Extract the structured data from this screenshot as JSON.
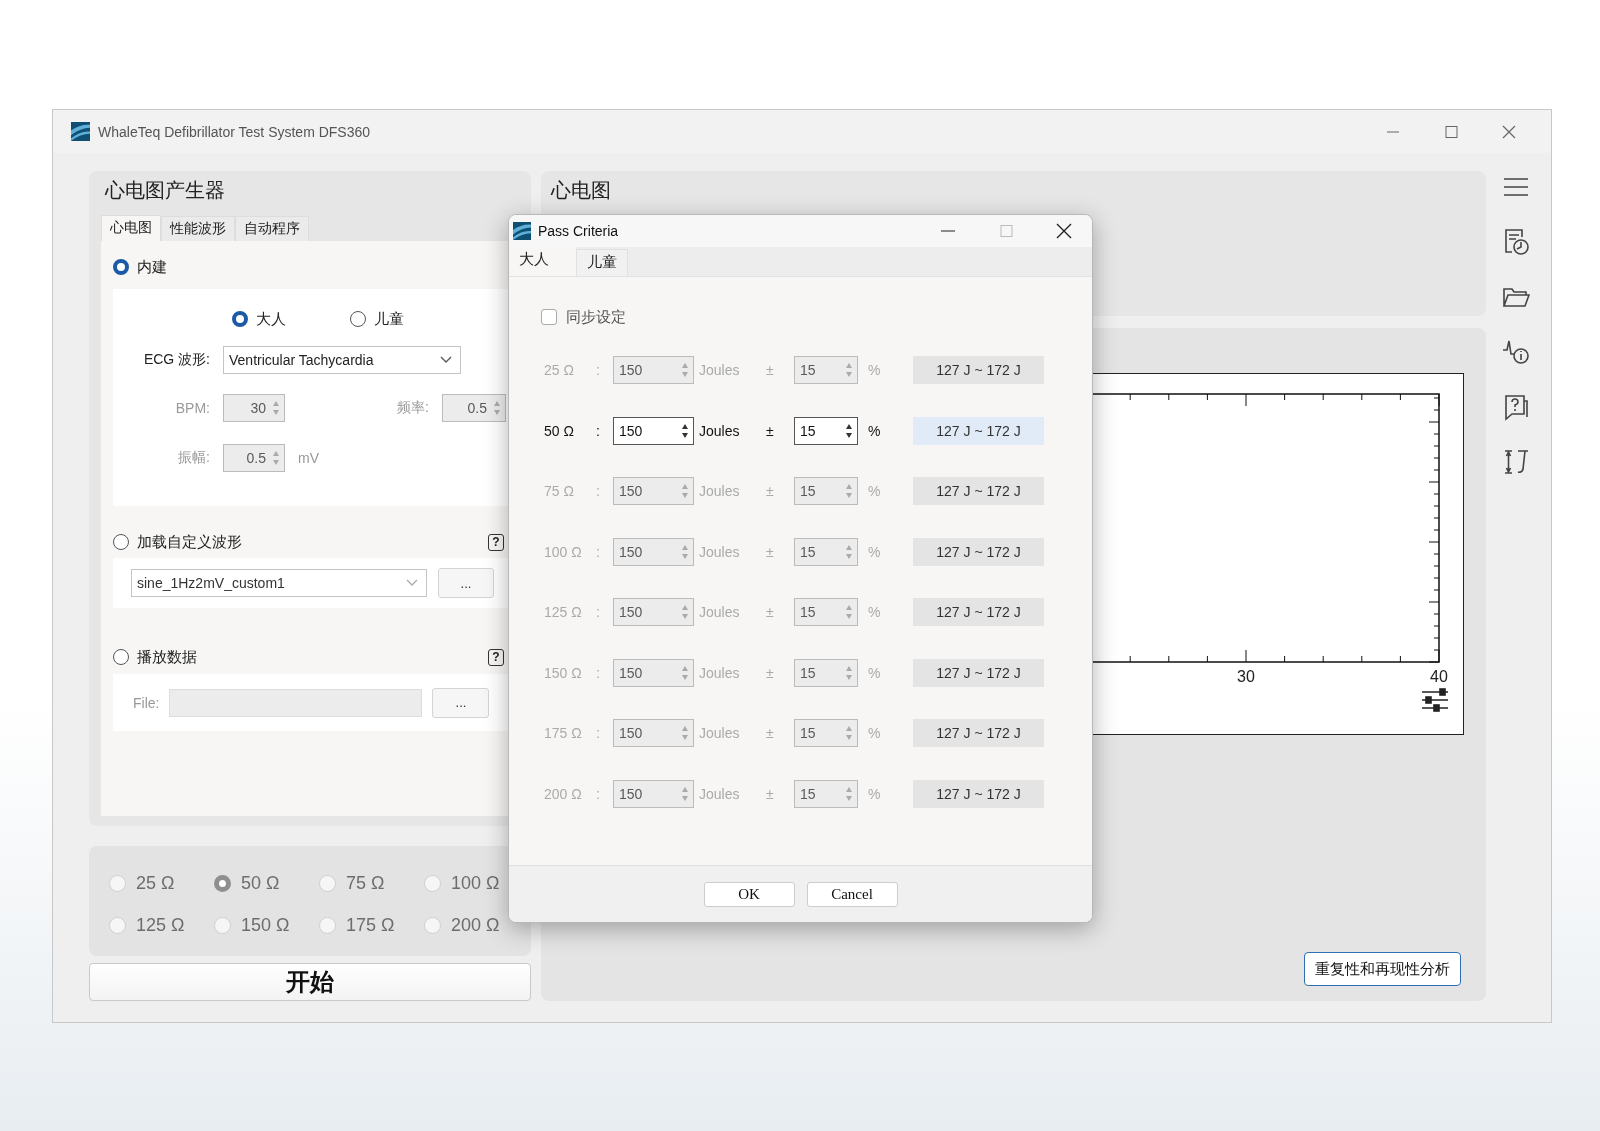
{
  "window": {
    "title": "WhaleTeq Defibrillator Test System DFS360"
  },
  "generator": {
    "title": "心电图产生器",
    "tabs": [
      {
        "label": "心电图",
        "selected": true
      },
      {
        "label": "性能波形",
        "selected": false
      },
      {
        "label": "自动程序",
        "selected": false
      }
    ],
    "builtin": {
      "label": "内建",
      "selected": true,
      "patient": [
        {
          "label": "大人",
          "selected": true
        },
        {
          "label": "儿童",
          "selected": false
        }
      ],
      "waveform": {
        "label": "ECG 波形:",
        "value": "Ventricular Tachycardia"
      },
      "bpm": {
        "label": "BPM:",
        "value": "30",
        "disabled": true
      },
      "frequency": {
        "label": "频率:",
        "value": "0.5",
        "disabled": true
      },
      "amplitude": {
        "label": "振幅:",
        "value": "0.5",
        "unit": "mV",
        "disabled": true
      }
    },
    "custom": {
      "label": "加载自定义波形",
      "selected": false,
      "help": "?",
      "file": "sine_1Hz2mV_custom1",
      "browse": "..."
    },
    "playback": {
      "label": "播放数据",
      "selected": false,
      "help": "?",
      "file_label": "File:",
      "browse": "..."
    },
    "loads": [
      {
        "label": "25 Ω",
        "selected": false
      },
      {
        "label": "50 Ω",
        "selected": true
      },
      {
        "label": "75 Ω",
        "selected": false
      },
      {
        "label": "100 Ω",
        "selected": false
      },
      {
        "label": "125 Ω",
        "selected": false
      },
      {
        "label": "150 Ω",
        "selected": false
      },
      {
        "label": "175 Ω",
        "selected": false
      },
      {
        "label": "200 Ω",
        "selected": false
      }
    ],
    "start_button": "开始"
  },
  "ecg": {
    "title": "心电图",
    "chart": {
      "x_tick_labels": [
        "30",
        "40"
      ]
    },
    "analysis_button": "重复性和再现性分析"
  },
  "dialog": {
    "title": "Pass Criteria",
    "tabs": [
      {
        "label": "大人",
        "selected": true
      },
      {
        "label": "儿童",
        "selected": false
      }
    ],
    "sync": {
      "label": "同步设定",
      "checked": false
    },
    "rows": [
      {
        "load": "25 Ω",
        "sep": ":",
        "energy": "150",
        "unit": "Joules",
        "pm": "±",
        "tolerance": "15",
        "percent": "%",
        "range": "127 J ~ 172 J",
        "disabled": true
      },
      {
        "load": "50 Ω",
        "sep": ":",
        "energy": "150",
        "unit": "Joules",
        "pm": "±",
        "tolerance": "15",
        "percent": "%",
        "range": "127 J ~ 172 J",
        "disabled": false
      },
      {
        "load": "75 Ω",
        "sep": ":",
        "energy": "150",
        "unit": "Joules",
        "pm": "±",
        "tolerance": "15",
        "percent": "%",
        "range": "127 J ~ 172 J",
        "disabled": true
      },
      {
        "load": "100 Ω",
        "sep": ":",
        "energy": "150",
        "unit": "Joules",
        "pm": "±",
        "tolerance": "15",
        "percent": "%",
        "range": "127 J ~ 172 J",
        "disabled": true
      },
      {
        "load": "125 Ω",
        "sep": ":",
        "energy": "150",
        "unit": "Joules",
        "pm": "±",
        "tolerance": "15",
        "percent": "%",
        "range": "127 J ~ 172 J",
        "disabled": true
      },
      {
        "load": "150 Ω",
        "sep": ":",
        "energy": "150",
        "unit": "Joules",
        "pm": "±",
        "tolerance": "15",
        "percent": "%",
        "range": "127 J ~ 172 J",
        "disabled": true
      },
      {
        "load": "175 Ω",
        "sep": ":",
        "energy": "150",
        "unit": "Joules",
        "pm": "±",
        "tolerance": "15",
        "percent": "%",
        "range": "127 J ~ 172 J",
        "disabled": true
      },
      {
        "load": "200 Ω",
        "sep": ":",
        "energy": "150",
        "unit": "Joules",
        "pm": "±",
        "tolerance": "15",
        "percent": "%",
        "range": "127 J ~ 172 J",
        "disabled": true
      }
    ],
    "buttons": [
      "OK",
      "Cancel"
    ]
  }
}
